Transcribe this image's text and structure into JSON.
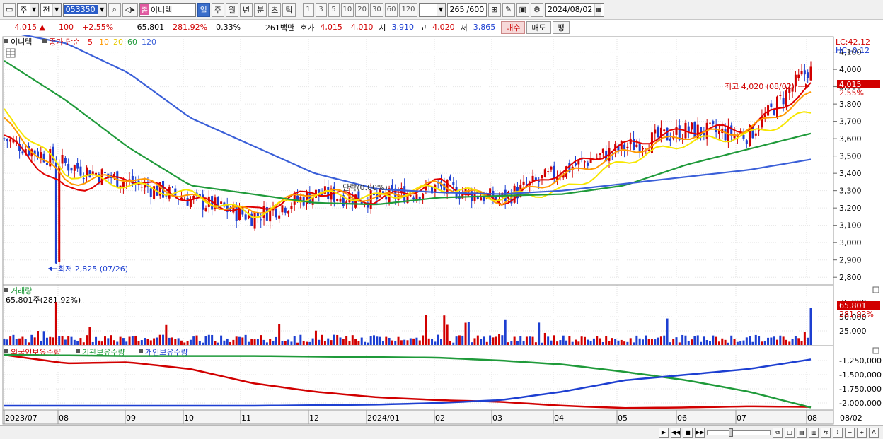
{
  "toolbar": {
    "period_main": "주",
    "prev_label": "전",
    "stock_code": "053350",
    "stock_tag": "종",
    "stock_name": "이니텍",
    "periods": [
      "일",
      "주",
      "월",
      "년",
      "분",
      "초",
      "틱"
    ],
    "active_period": "일",
    "intervals": [
      "1",
      "3",
      "5",
      "10",
      "20",
      "30",
      "60",
      "120"
    ],
    "count": "265",
    "count_max": "/600",
    "date": "2024/08/02"
  },
  "quote": {
    "price": "4,015",
    "change": "100",
    "change_pct": "+2.55%",
    "volume": "65,801",
    "volume_ratio": "281.92%",
    "turnover": "0.33%",
    "amount": "261백만",
    "ask_label": "호가",
    "ask": "4,015",
    "bid": "4,010",
    "open_label": "시",
    "open": "3,910",
    "high_label": "고",
    "high": "4,020",
    "low_label": "저",
    "low": "3,865",
    "buy_button": "매수",
    "sell_button": "매도",
    "eval_button": "평"
  },
  "legend": {
    "stock": "이니텍",
    "ma_label": "종가 단순",
    "ma_periods": [
      "5",
      "10",
      "20",
      "60",
      "120"
    ],
    "volume_title": "거래량",
    "volume_sub": "65,801주(281.92%)",
    "holdings": [
      "외국인보유수량",
      "기관보유수량",
      "개인보유수량"
    ]
  },
  "annotations": {
    "lc": "LC:42.12",
    "hc": "HC:-0.12",
    "high": "최고 4,020 (08/02)",
    "low": "최저 2,825 (07/26)",
    "mid": "단락(0.00%)",
    "price_tag": "4,015",
    "price_pct": "2.55%",
    "vol_tag": "65,801",
    "vol_pct": "281.92%"
  },
  "colors": {
    "up": "#d10000",
    "down": "#1d3fd1",
    "ma5": "#e00000",
    "ma10": "#ff9900",
    "ma20": "#f7e600",
    "ma60": "#1f9a3a",
    "ma120": "#3a5fd8"
  },
  "chart_data": [
    {
      "type": "line",
      "title": "",
      "series": [
        {
          "name": "종가",
          "x": [
            "2023/07",
            "2023/08",
            "2023/09",
            "2023/10",
            "2023/11",
            "2023/12",
            "2024/01",
            "2024/02",
            "2024/03",
            "2024/04",
            "2024/05",
            "2024/06",
            "2024/07",
            "2024/08/02"
          ],
          "values": [
            3600,
            3450,
            3350,
            3250,
            3150,
            3280,
            3250,
            3320,
            3250,
            3420,
            3550,
            3650,
            3620,
            4015
          ]
        },
        {
          "name": "5",
          "values": [
            3620,
            3300,
            3380,
            3250,
            3180,
            3300,
            3240,
            3350,
            3230,
            3420,
            3560,
            3650,
            3660,
            3900
          ]
        },
        {
          "name": "10",
          "values": [
            3700,
            3350,
            3380,
            3260,
            3170,
            3300,
            3250,
            3340,
            3240,
            3380,
            3520,
            3620,
            3650,
            3850
          ]
        },
        {
          "name": "20",
          "values": [
            3750,
            3400,
            3330,
            3280,
            3160,
            3280,
            3260,
            3320,
            3260,
            3300,
            3470,
            3580,
            3620,
            3750
          ]
        },
        {
          "name": "60",
          "values": [
            4050,
            3820,
            3550,
            3330,
            3280,
            3230,
            3220,
            3260,
            3270,
            3280,
            3330,
            3450,
            3540,
            3630
          ]
        },
        {
          "name": "120",
          "values": [
            4220,
            4150,
            3980,
            3720,
            3560,
            3400,
            3310,
            3290,
            3280,
            3300,
            3340,
            3380,
            3420,
            3480
          ]
        }
      ],
      "yticks": [
        2800,
        2900,
        3000,
        3100,
        3200,
        3300,
        3400,
        3500,
        3600,
        3700,
        3800,
        3900,
        4000,
        4100
      ],
      "ylim": [
        2760,
        4180
      ],
      "high": 4020,
      "low": 2825
    },
    {
      "type": "bar",
      "title": "거래량",
      "yticks": [
        "25,000",
        "50,000",
        "75,000"
      ],
      "ylim": [
        0,
        85000
      ],
      "last": 65801
    },
    {
      "type": "line",
      "title": "보유수량",
      "series": [
        {
          "name": "외국인보유수량",
          "values": [
            -1150000,
            -1300000,
            -1280000,
            -1400000,
            -1650000,
            -1800000,
            -1900000,
            -1950000,
            -1980000,
            -2050000,
            -2090000,
            -2080000,
            -2060000,
            -2070000
          ]
        },
        {
          "name": "기관보유수량",
          "values": [
            -1150000,
            -1160000,
            -1170000,
            -1170000,
            -1170000,
            -1180000,
            -1190000,
            -1200000,
            -1250000,
            -1320000,
            -1450000,
            -1600000,
            -1800000,
            -2080000
          ]
        },
        {
          "name": "개인보유수량",
          "values": [
            -2050000,
            -2050000,
            -2050000,
            -2050000,
            -2050000,
            -2040000,
            -2030000,
            -2000000,
            -1950000,
            -1800000,
            -1600000,
            -1500000,
            -1400000,
            -1230000
          ]
        }
      ],
      "yticks": [
        "-1,250,000",
        "-1,500,000",
        "-1,750,000",
        "-2,000,000"
      ],
      "ylim": [
        -2100000,
        -1150000
      ]
    }
  ],
  "x_axis_labels": [
    "2023/07",
    "08",
    "09",
    "10",
    "11",
    "12",
    "2024/01",
    "02",
    "03",
    "04",
    "05",
    "06",
    "07",
    "08",
    "08/02"
  ]
}
